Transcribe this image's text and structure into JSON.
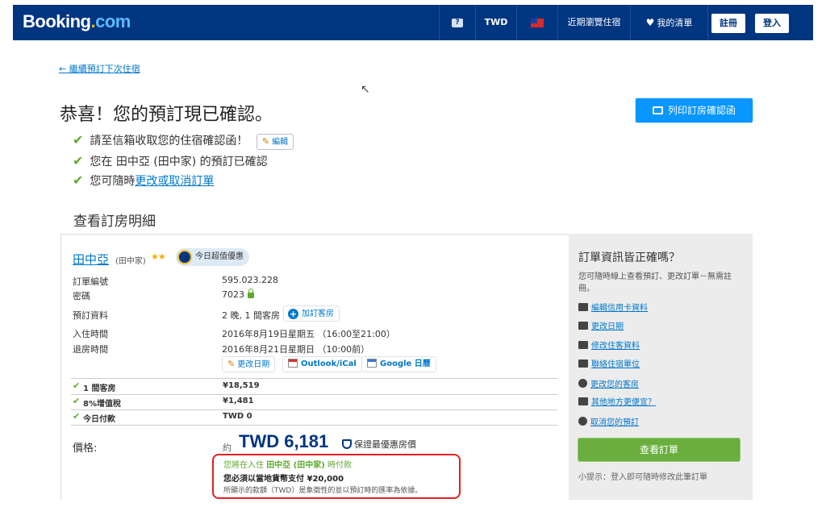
{
  "header": {
    "logo_main": "Booking",
    "logo_dot": ".",
    "logo_tld": "com",
    "help_glyph": "?",
    "currency": "TWD",
    "recently_viewed": "近期瀏覽住宿",
    "wishlist": "我的清單",
    "register": "註冊",
    "login": "登入"
  },
  "back_link": "← 繼續預訂下次住宿",
  "title": "恭喜！您的預訂現已確認。",
  "print_button": "列印訂房確認函",
  "checks": {
    "line1": "請至信箱收取您的住宿確認函！",
    "edit": "編輯",
    "line2": "您在 田中亞 (田中家) 的預訂已確認",
    "line3_prefix": "您可隨時",
    "line3_link": "更改或取消訂單"
  },
  "section_title": "查看訂房明細",
  "hotel": {
    "name": "田中亞",
    "sub": "(田中家)",
    "stars": "★★",
    "deal": "今日超值優惠"
  },
  "details": {
    "booking_no_label": "訂單編號",
    "booking_no": "595.023.228",
    "pin_label": "密碼",
    "pin": "7023",
    "booking_info_label": "預訂資料",
    "booking_info": "2 晚, 1 間客房",
    "add_guest": "加訂客房",
    "checkin_label": "入住時間",
    "checkin": "2016年8月19日星期五 （16:00至21:00）",
    "checkout_label": "退房時間",
    "checkout": "2016年8月21日星期日 （10:00前）",
    "change_date": "更改日期",
    "outlook": "Outlook/iCal",
    "google": "Google 日曆"
  },
  "fees": [
    {
      "label": "1 間客房",
      "value": "¥18,519"
    },
    {
      "label": "8%增值稅",
      "value": "¥1,481"
    },
    {
      "label": "今日付款",
      "value": "TWD 0"
    }
  ],
  "price": {
    "label": "價格:",
    "approx": "約",
    "amount": "TWD 6,181",
    "best": "保證最優惠房價",
    "pay_prefix": "您將在入住",
    "pay_hotel": "田中亞 (田中家)",
    "pay_suffix": "時付款",
    "local_currency": "您必須以當地貨幣支付 ¥20,000",
    "note": "所顯示的款額（TWD）是象徵性的並以預訂時的匯率為依據。"
  },
  "side": {
    "title": "訂單資訊皆正確嗎？",
    "desc": "您可隨時線上查看預訂、更改訂單－無需註冊。",
    "links": [
      {
        "icon": "credit-card-icon",
        "label": "編輯信用卡資料"
      },
      {
        "icon": "calendar-icon",
        "label": "更改日期"
      },
      {
        "icon": "person-icon",
        "label": "修改住客資料"
      },
      {
        "icon": "chat-icon",
        "label": "聯絡住宿單位"
      },
      {
        "icon": "bed-icon",
        "label": "更改您的客房"
      },
      {
        "icon": "money-icon",
        "label": "其他地方更便宜？"
      },
      {
        "icon": "cancel-icon",
        "label": "取消您的預訂"
      }
    ],
    "view_button": "查看訂單",
    "tip": "小提示：登入即可隨時修改此筆訂單"
  }
}
